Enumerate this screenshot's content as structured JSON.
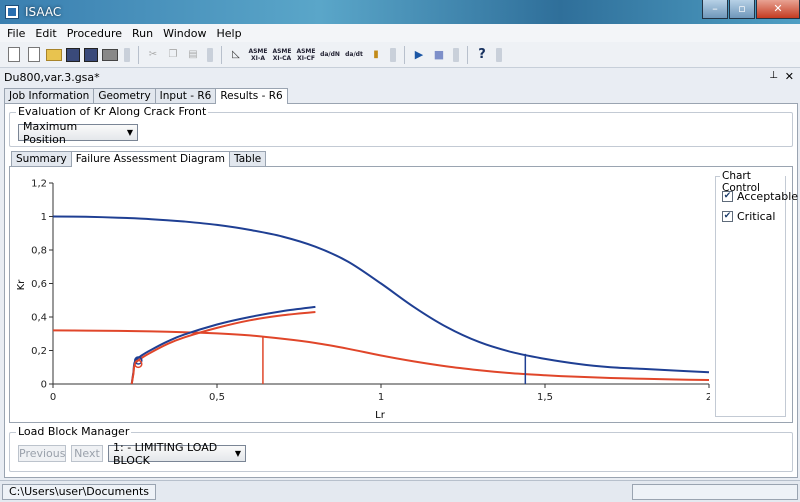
{
  "window": {
    "title": "ISAAC",
    "min": "–",
    "max": "▫",
    "close": "✕"
  },
  "menu": [
    "File",
    "Edit",
    "Procedure",
    "Run",
    "Window",
    "Help"
  ],
  "toolbar": {
    "asme1": [
      "ASME",
      "XI-A"
    ],
    "asme2": [
      "ASME",
      "XI-CA"
    ],
    "asme3": [
      "ASME",
      "XI-CF"
    ],
    "da1": "da/dN",
    "da2": "da/dt"
  },
  "document": {
    "title": "Du800,var.3.gsa*",
    "pin": "⊥",
    "close": "✕"
  },
  "main_tabs": [
    "Job Information",
    "Geometry",
    "Input - R6",
    "Results - R6"
  ],
  "evaluation": {
    "title": "Evaluation of Kr Along Crack Front",
    "selected": "Maximum Position"
  },
  "sub_tabs": [
    "Summary",
    "Failure Assessment Diagram",
    "Table"
  ],
  "chart_control": {
    "title": "Chart Control",
    "items": [
      {
        "label": "Acceptable",
        "checked": true
      },
      {
        "label": "Critical",
        "checked": true
      }
    ]
  },
  "load_block": {
    "title": "Load Block Manager",
    "previous": "Previous",
    "next": "Next",
    "selected": "1:  - LIMITING LOAD BLOCK"
  },
  "status": {
    "path": "C:\\Users\\user\\Documents"
  },
  "chart_data": {
    "type": "line",
    "xlabel": "Lr",
    "ylabel": "Kr",
    "xlim": [
      0,
      2
    ],
    "ylim": [
      0,
      1.2
    ],
    "x_ticks": [
      "0",
      "0,5",
      "1",
      "1,5",
      "2"
    ],
    "y_ticks": [
      "0",
      "0,2",
      "0,4",
      "0,6",
      "0,8",
      "1",
      "1,2"
    ],
    "grid": false,
    "series": [
      {
        "color": "#1f3f93",
        "x": [
          0,
          0.1,
          0.2,
          0.3,
          0.4,
          0.5,
          0.6,
          0.7,
          0.8,
          0.9,
          1.0,
          1.1,
          1.2,
          1.3,
          1.4,
          1.5,
          1.6,
          1.7,
          1.8,
          1.9,
          2.0
        ],
        "y": [
          1.0,
          0.998,
          0.993,
          0.984,
          0.97,
          0.95,
          0.92,
          0.88,
          0.82,
          0.73,
          0.6,
          0.46,
          0.34,
          0.25,
          0.19,
          0.15,
          0.12,
          0.1,
          0.09,
          0.08,
          0.07
        ]
      },
      {
        "color": "#e0462a",
        "x": [
          0,
          0.1,
          0.2,
          0.3,
          0.4,
          0.5,
          0.6,
          0.7,
          0.8,
          0.9,
          1.0,
          1.1,
          1.2,
          1.3,
          1.4,
          1.5,
          1.6,
          1.7,
          1.8,
          1.9,
          2.0
        ],
        "y": [
          0.32,
          0.319,
          0.317,
          0.314,
          0.309,
          0.302,
          0.29,
          0.27,
          0.245,
          0.21,
          0.17,
          0.135,
          0.105,
          0.082,
          0.064,
          0.052,
          0.043,
          0.036,
          0.031,
          0.027,
          0.024
        ]
      },
      {
        "color": "#1f3f93",
        "x": [
          0.24,
          0.245,
          0.25,
          0.27,
          0.3,
          0.35,
          0.4,
          0.5,
          0.6,
          0.7,
          0.8
        ],
        "y": [
          0.0,
          0.07,
          0.135,
          0.17,
          0.205,
          0.255,
          0.295,
          0.355,
          0.4,
          0.435,
          0.46
        ]
      },
      {
        "color": "#e0462a",
        "x": [
          0.24,
          0.245,
          0.25,
          0.27,
          0.3,
          0.35,
          0.4,
          0.5,
          0.6,
          0.7,
          0.8
        ],
        "y": [
          0.0,
          0.06,
          0.12,
          0.155,
          0.19,
          0.24,
          0.278,
          0.335,
          0.38,
          0.41,
          0.43
        ]
      }
    ],
    "verticals": [
      {
        "color": "#e0462a",
        "x": 0.64,
        "y0": 0,
        "y1": 0.28
      },
      {
        "color": "#1f3f93",
        "x": 1.44,
        "y0": 0,
        "y1": 0.18
      }
    ],
    "markers": [
      {
        "color": "#1f3f93",
        "x": 0.26,
        "y": 0.14
      },
      {
        "color": "#e0462a",
        "x": 0.26,
        "y": 0.12
      }
    ]
  }
}
